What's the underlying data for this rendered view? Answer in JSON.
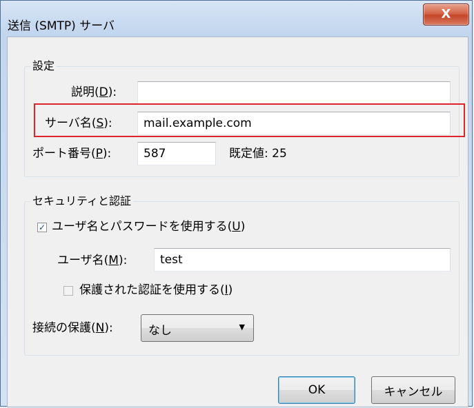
{
  "window": {
    "title": "送信 (SMTP) サーバ",
    "close_glyph": "X"
  },
  "settings": {
    "group_label": "設定",
    "description_label": "説明(",
    "description_key": "D",
    "description_suffix": "):",
    "description_value": "",
    "server_label": "サーバ名(",
    "server_key": "S",
    "server_suffix": "):",
    "server_value": "mail.example.com",
    "port_label": "ポート番号(",
    "port_key": "P",
    "port_suffix": "):",
    "port_value": "587",
    "default_label": "既定値:",
    "default_value": "25"
  },
  "security": {
    "group_label": "セキュリティと認証",
    "use_password_label": "ユーザ名とパスワードを使用する(",
    "use_password_key": "U",
    "use_password_suffix": ")",
    "use_password_checked": true,
    "username_label": "ユーザ名(",
    "username_key": "M",
    "username_suffix": "):",
    "username_value": "test",
    "secure_auth_label": "保護された認証を使用する(",
    "secure_auth_key": "I",
    "secure_auth_suffix": ")",
    "secure_auth_checked": false,
    "connection_label": "接続の保護(",
    "connection_key": "N",
    "connection_suffix": "):",
    "connection_value": "なし"
  },
  "buttons": {
    "ok": "OK",
    "cancel": "キャンセル"
  },
  "check_glyph": "✓",
  "dropdown_glyph": "▼"
}
